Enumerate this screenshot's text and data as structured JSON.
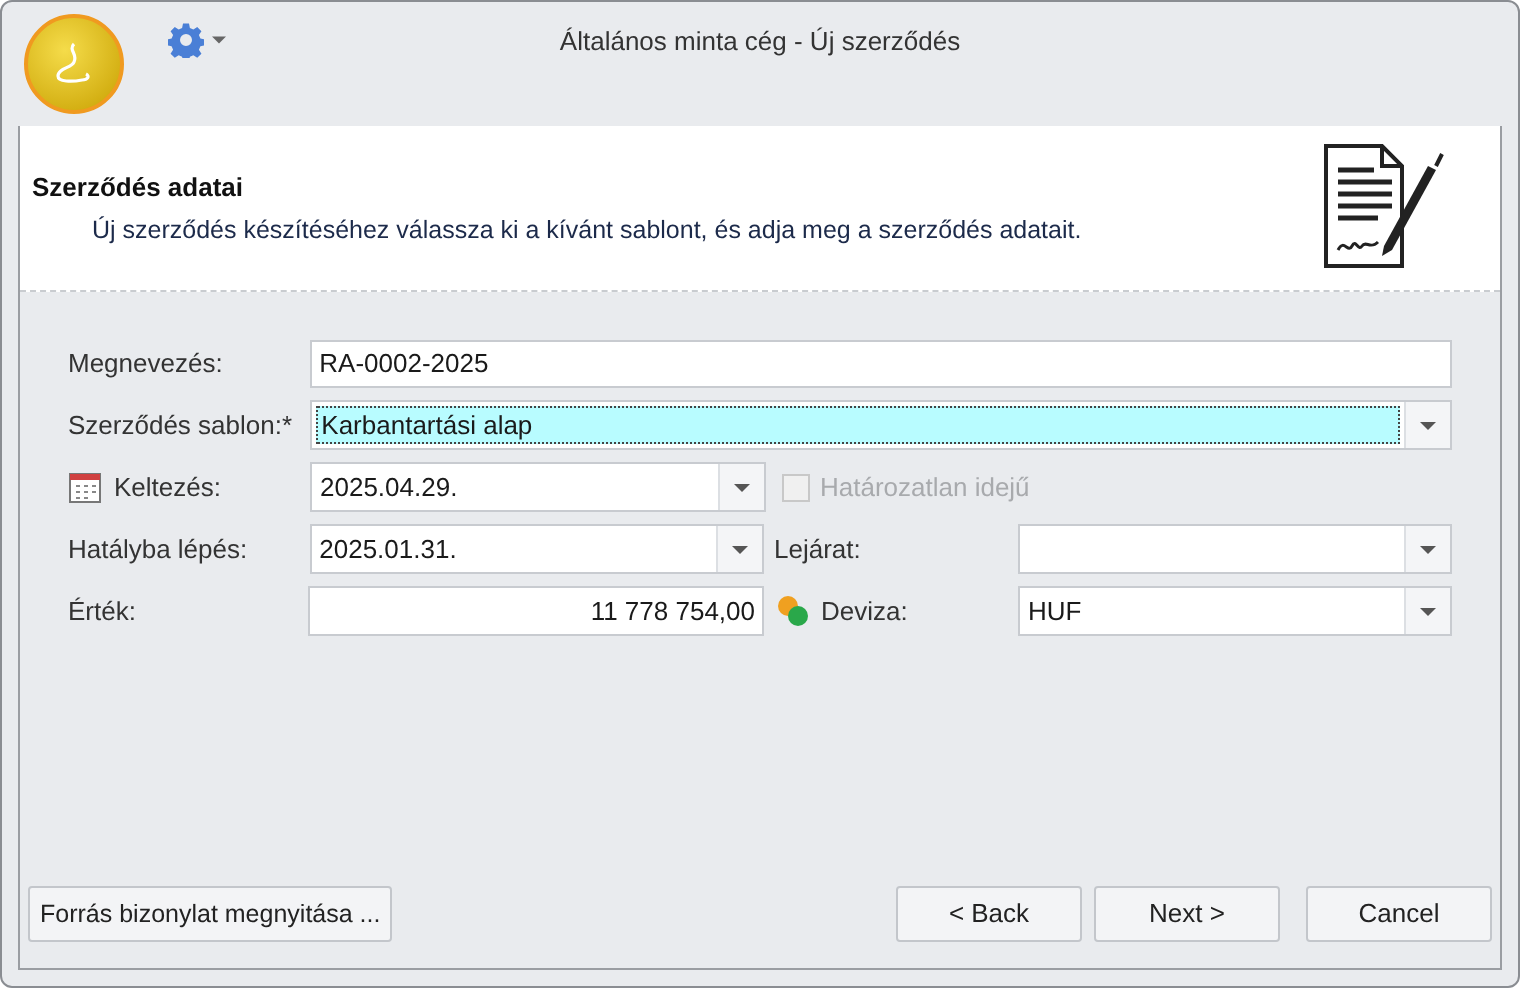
{
  "window": {
    "title": "Általános minta cég - Új szerződés"
  },
  "header": {
    "title": "Szerződés adatai",
    "description": "Új szerződés készítéséhez válassza ki a kívánt sablont, és adja meg a szerződés adatait."
  },
  "form": {
    "name": {
      "label": "Megnevezés:",
      "value": "RA-0002-2025"
    },
    "template": {
      "label": "Szerződés sablon:*",
      "value": "Karbantartási alap",
      "focused": true
    },
    "date": {
      "label": "Keltezés:",
      "value": "2025.04.29."
    },
    "indefinite": {
      "label": "Határozatlan idejű",
      "checked": false,
      "disabled": true
    },
    "effective": {
      "label": "Hatályba lépés:",
      "value": "2025.01.31."
    },
    "expiry": {
      "label": "Lejárat:"
    },
    "amount": {
      "label": "Érték:",
      "value": "11 778 754,00"
    },
    "currency": {
      "label": "Deviza:",
      "value": "HUF"
    }
  },
  "buttons": {
    "source": "Forrás bizonylat megnyitása ...",
    "back": "< Back",
    "next": "Next >",
    "cancel": "Cancel"
  }
}
